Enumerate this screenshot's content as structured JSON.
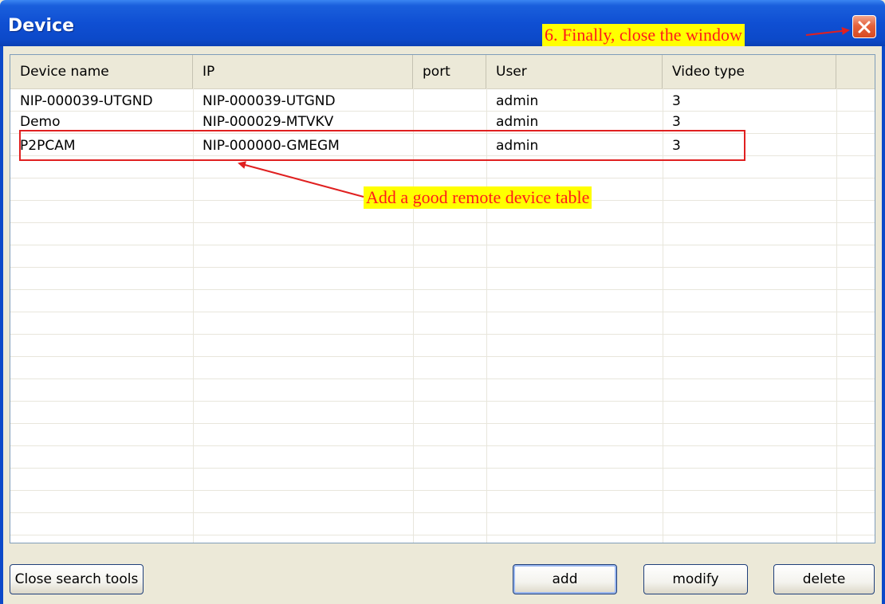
{
  "window": {
    "title": "Device"
  },
  "table": {
    "columns": [
      "Device name",
      "IP",
      "port",
      "User",
      "Video type"
    ],
    "rows": [
      [
        "NIP-000039-UTGND",
        "NIP-000039-UTGND",
        "",
        "admin",
        "3"
      ],
      [
        "Demo",
        "NIP-000029-MTVKV",
        "",
        "admin",
        "3"
      ],
      [
        "P2PCAM",
        "NIP-000000-GMEGM",
        "",
        "admin",
        "3"
      ]
    ]
  },
  "buttons": {
    "close_search_tools": "Close search tools",
    "add": "add",
    "modify": "modify",
    "delete": "delete"
  },
  "annotations": {
    "close_hint": "6. Finally, close the window",
    "table_hint": "Add a good remote device table"
  },
  "colors": {
    "titlebar": "#0c49c9",
    "annotation_bg": "#ffff00",
    "annotation_text": "#ff1a1a",
    "highlight_box": "#e02020"
  },
  "icons": {
    "close": "close-icon"
  }
}
